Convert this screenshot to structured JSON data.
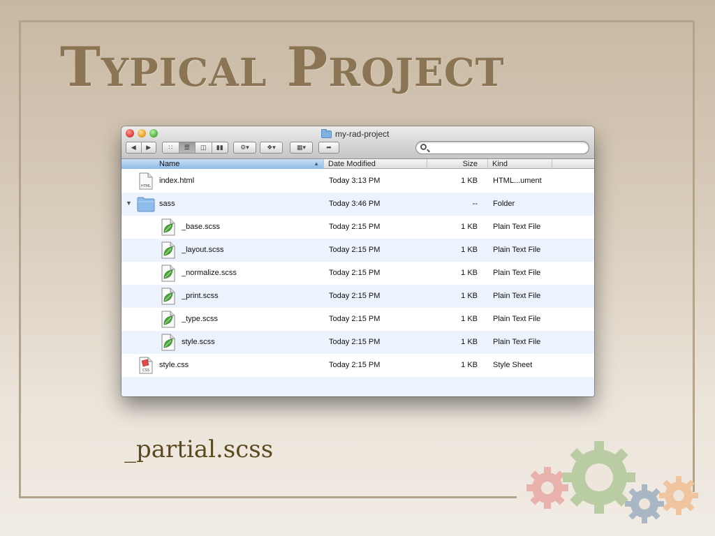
{
  "slide": {
    "title": "Typical Project",
    "caption": "_partial.scss"
  },
  "window": {
    "title": "my-rad-project",
    "columns": {
      "name": "Name",
      "date": "Date Modified",
      "size": "Size",
      "kind": "Kind"
    },
    "search": {
      "placeholder": ""
    },
    "rows": [
      {
        "name": "index.html",
        "date": "Today 3:13 PM",
        "size": "1 KB",
        "kind": "HTML...ument",
        "icon": "html-file-icon",
        "indent": 0
      },
      {
        "name": "sass",
        "date": "Today 3:46 PM",
        "size": "--",
        "kind": "Folder",
        "icon": "folder-icon",
        "indent": 0,
        "expanded": true
      },
      {
        "name": "_base.scss",
        "date": "Today 2:15 PM",
        "size": "1 KB",
        "kind": "Plain Text File",
        "icon": "scss-file-icon",
        "indent": 1
      },
      {
        "name": "_layout.scss",
        "date": "Today 2:15 PM",
        "size": "1 KB",
        "kind": "Plain Text File",
        "icon": "scss-file-icon",
        "indent": 1
      },
      {
        "name": "_normalize.scss",
        "date": "Today 2:15 PM",
        "size": "1 KB",
        "kind": "Plain Text File",
        "icon": "scss-file-icon",
        "indent": 1
      },
      {
        "name": "_print.scss",
        "date": "Today 2:15 PM",
        "size": "1 KB",
        "kind": "Plain Text File",
        "icon": "scss-file-icon",
        "indent": 1
      },
      {
        "name": "_type.scss",
        "date": "Today 2:15 PM",
        "size": "1 KB",
        "kind": "Plain Text File",
        "icon": "scss-file-icon",
        "indent": 1
      },
      {
        "name": "style.scss",
        "date": "Today 2:15 PM",
        "size": "1 KB",
        "kind": "Plain Text File",
        "icon": "scss-file-icon",
        "indent": 1
      },
      {
        "name": "style.css",
        "date": "Today 2:15 PM",
        "size": "1 KB",
        "kind": "Style Sheet",
        "icon": "css-file-icon",
        "indent": 0
      }
    ],
    "icon_labels": {
      "html": "HTML",
      "css": "CSS"
    }
  },
  "colors": {
    "title": "#8a7454",
    "caption": "#5c4a1f",
    "frame": "#b3a38b",
    "selected_header": "#8fbbe8",
    "row_alt": "#edf3fd"
  }
}
